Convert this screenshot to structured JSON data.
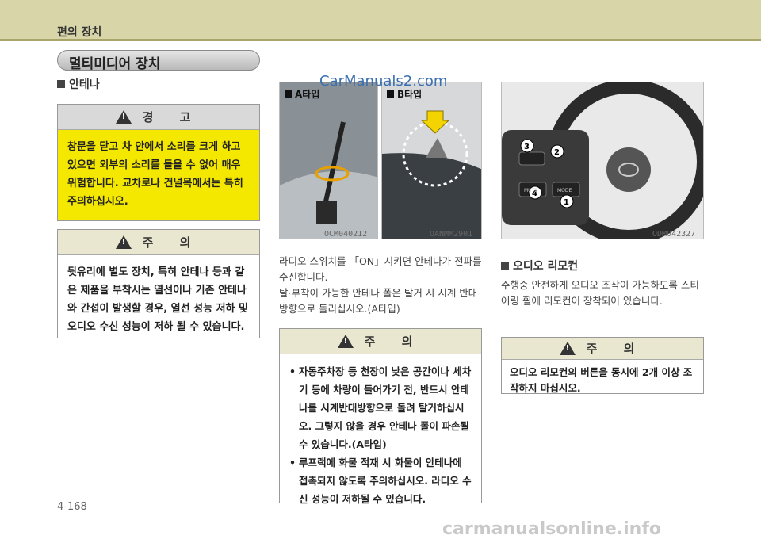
{
  "header": {
    "title": "편의 장치"
  },
  "section": {
    "title": "멀티미디어 장치"
  },
  "antenna_heading": "안테나",
  "warning_box": {
    "title": "경 고",
    "body": "창문을 닫고 차 안에서 소리를 크게 하고 있으면 외부의 소리를 들을 수 없어 매우 위험합니다. 교차로나 건널목에서는 특히 주의하십시오."
  },
  "caution_box_1": {
    "title": "주 의",
    "body": "뒷유리에 별도 장치, 특히 안테나 등과 같은 제품을 부착시는 열선이나 기존 안테나와 간섭이 발생할 경우, 열선 성능 저하 및 오디오 수신 성능이 저하 될 수 있습니다."
  },
  "photo_antenna": {
    "label_a": "A타입",
    "label_b": "B타입",
    "code_a": "OCM040212",
    "code_b": "OANMM2901"
  },
  "watermark_top": "CarManuals2.com",
  "antenna_paragraph": {
    "line1": "라디오 스위치를 「ON」시키면 안테나가 전파를 수신합니다.",
    "line2": "탈·부착이 가능한 안테나 폴은 탈거 시 시계 반대 방향으로 돌리십시오.(A타입)"
  },
  "caution_box_2": {
    "title": "주 의",
    "items": [
      "자동주차장 등 천장이 낮은 공간이나 세차기 등에 차량이 들어가기 전, 반드시 안테나를 시계반대방향으로 돌려 탈거하십시오. 그렇지 않을 경우 안테나 폴이 파손될 수 있습니다.(A타입)",
      "루프랙에 화물 적재 시 화물이 안테나에 접촉되지 않도록 주의하십시오. 라디오 수신 성능이 저하될 수 있습니다."
    ]
  },
  "photo_wheel": {
    "code": "ODM042327",
    "callouts": [
      "3",
      "2",
      "4",
      "1"
    ],
    "button_labels": [
      "MUTE",
      "MODE"
    ]
  },
  "remote_heading": "오디오 리모컨",
  "remote_paragraph": "주행중 안전하게 오디오 조작이 가능하도록 스티어링 휠에 리모컨이 장착되어 있습니다.",
  "caution_box_3": {
    "title": "주 의",
    "body": "오디오 리모컨의 버튼을 동시에 2개 이상 조작하지 마십시오."
  },
  "page_number": "4-168",
  "footer_watermark": "carmanualsonline.info",
  "colors": {
    "warning_yellow": "#f5e800",
    "header_band": "#d8d6a8",
    "highlight_orange": "#e8a000"
  }
}
